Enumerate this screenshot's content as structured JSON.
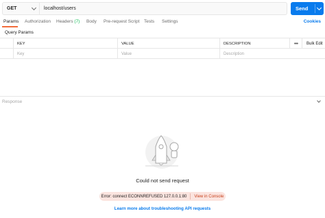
{
  "request": {
    "method": "GET",
    "url": "localhost/users",
    "send_label": "Send"
  },
  "tabs": [
    {
      "label": "Params",
      "active": true
    },
    {
      "label": "Authorization"
    },
    {
      "label": "Headers",
      "count": "(7)"
    },
    {
      "label": "Body"
    },
    {
      "label": "Pre-request Script"
    },
    {
      "label": "Tests"
    },
    {
      "label": "Settings"
    }
  ],
  "cookies_label": "Cookies",
  "params": {
    "title": "Query Params",
    "columns": [
      "KEY",
      "VALUE",
      "DESCRIPTION"
    ],
    "placeholders": [
      "Key",
      "Value",
      "Description"
    ],
    "more_label": "•••",
    "bulk_edit_label": "Bulk Edit"
  },
  "response": {
    "label": "Response",
    "error_title": "Could not send request",
    "error_message": "Error: connect ECONNREFUSED 127.0.0.1:80",
    "console_link": "View in Console",
    "learn_more": "Learn more about troubleshooting API requests"
  },
  "colors": {
    "accent": "#097bed",
    "active_tab": "#f26b3a",
    "error_bg": "#fbe4df",
    "error_link": "#c7411d",
    "headers_count": "#0cbb52"
  }
}
